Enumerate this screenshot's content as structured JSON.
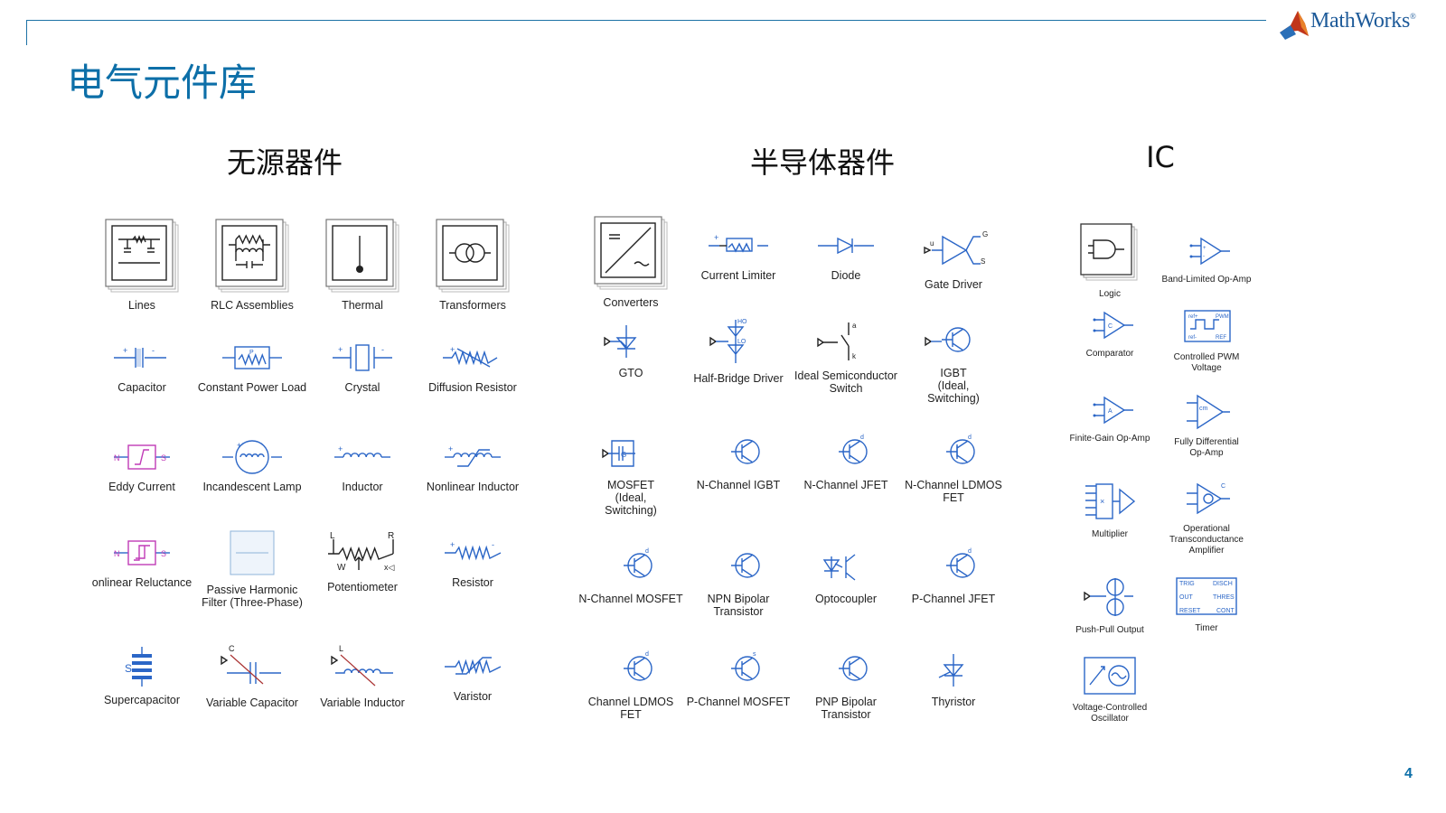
{
  "slide_title": "电气元件库",
  "brand": {
    "name": "MathWorks",
    "reg": "®"
  },
  "page_number": "4",
  "sections": {
    "passive": "无源器件",
    "semi": "半导体器件",
    "ic": "IC"
  },
  "passive_items": [
    "Lines",
    "RLC Assemblies",
    "Thermal",
    "Transformers",
    "Capacitor",
    "Constant Power Load",
    "Crystal",
    "Diffusion Resistor",
    "Eddy Current",
    "Incandescent Lamp",
    "Inductor",
    "Nonlinear Inductor",
    "onlinear Reluctance",
    "Passive Harmonic\nFilter (Three-Phase)",
    "Potentiometer",
    "Resistor",
    "Supercapacitor",
    "Variable Capacitor",
    "Variable Inductor",
    "Varistor"
  ],
  "semi_items": [
    "Converters",
    "Current Limiter",
    "Diode",
    "Gate Driver",
    "GTO",
    "Half-Bridge Driver",
    "Ideal Semiconductor\nSwitch",
    "IGBT\n(Ideal,\nSwitching)",
    "MOSFET\n(Ideal,\nSwitching)",
    "N-Channel IGBT",
    "N-Channel JFET",
    "N-Channel LDMOS FET",
    "N-Channel MOSFET",
    "NPN Bipolar\nTransistor",
    "Optocoupler",
    "P-Channel JFET",
    "Channel LDMOS FET",
    "P-Channel MOSFET",
    "PNP Bipolar\nTransistor",
    "Thyristor"
  ],
  "ic_items": [
    "Logic",
    "Band-Limited Op-Amp",
    "Comparator",
    "Controlled PWM\nVoltage",
    "Finite-Gain Op-Amp",
    "Fully Differential\nOp-Amp",
    "Multiplier",
    "Operational\nTransconductance\nAmplifier",
    "Push-Pull Output",
    "Timer",
    "Voltage-Controlled\nOscillator"
  ],
  "icon_names": {
    "passive": [
      "lines-library-icon",
      "rlc-library-icon",
      "thermal-library-icon",
      "transformers-library-icon",
      "capacitor-icon",
      "constant-power-load-icon",
      "crystal-icon",
      "diffusion-resistor-icon",
      "eddy-current-icon",
      "incandescent-lamp-icon",
      "inductor-icon",
      "nonlinear-inductor-icon",
      "nonlinear-reluctance-icon",
      "passive-harmonic-filter-icon",
      "potentiometer-icon",
      "resistor-icon",
      "supercapacitor-icon",
      "variable-capacitor-icon",
      "variable-inductor-icon",
      "varistor-icon"
    ],
    "semi": [
      "converters-library-icon",
      "current-limiter-icon",
      "diode-icon",
      "gate-driver-icon",
      "gto-icon",
      "half-bridge-driver-icon",
      "ideal-switch-icon",
      "igbt-icon",
      "mosfet-icon",
      "n-channel-igbt-icon",
      "n-channel-jfet-icon",
      "n-channel-ldmos-icon",
      "n-channel-mosfet-icon",
      "npn-transistor-icon",
      "optocoupler-icon",
      "p-channel-jfet-icon",
      "p-channel-ldmos-icon",
      "p-channel-mosfet-icon",
      "pnp-transistor-icon",
      "thyristor-icon"
    ],
    "ic": [
      "logic-library-icon",
      "band-limited-opamp-icon",
      "comparator-icon",
      "controlled-pwm-icon",
      "finite-gain-opamp-icon",
      "fully-differential-opamp-icon",
      "multiplier-icon",
      "ota-icon",
      "push-pull-icon",
      "timer-icon",
      "vco-icon"
    ]
  },
  "colors": {
    "accent": "#0d6fa8",
    "symbol_blue": "#2b66c7",
    "symbol_pink": "#c03bb7",
    "rule": "#1d72a6"
  }
}
